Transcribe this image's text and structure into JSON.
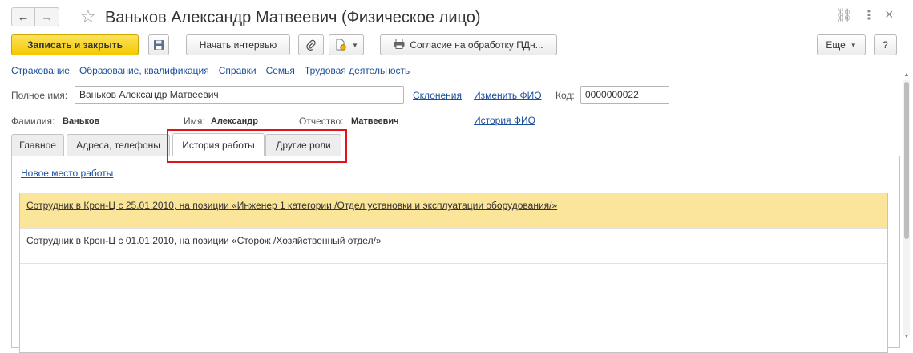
{
  "window": {
    "title": "Ваньков Александр Матвеевич (Физическое лицо)",
    "back_icon": "←",
    "forward_icon": "→",
    "favorite_icon": "☆",
    "link_icon": "⛓",
    "more_icon": "⋮",
    "close_icon": "×"
  },
  "toolbar": {
    "save_close_label": "Записать и закрыть",
    "start_interview_label": "Начать интервью",
    "consent_label": "Согласие на обработку ПДн...",
    "more_label": "Еще",
    "help_label": "?"
  },
  "links": [
    "Страхование",
    "Образование, квалификация",
    "Справки",
    "Семья",
    "Трудовая деятельность"
  ],
  "person": {
    "full_name_label": "Полное имя:",
    "full_name_value": "Ваньков Александр Матвеевич",
    "declensions_link": "Склонения",
    "change_name_link": "Изменить ФИО",
    "code_label": "Код:",
    "code_value": "0000000022",
    "surname_label": "Фамилия:",
    "surname_value": "Ваньков",
    "name_label": "Имя:",
    "name_value": "Александр",
    "patronymic_label": "Отчество:",
    "patronymic_value": "Матвеевич",
    "name_history_link": "История ФИО"
  },
  "tabs": [
    "Главное",
    "Адреса, телефоны",
    "История работы",
    "Другие роли"
  ],
  "active_tab": "История работы",
  "work_history": {
    "new_workplace_link": "Новое место работы",
    "items": [
      "Сотрудник в Крон-Ц с 25.01.2010, на позиции «Инженер 1 категории /Отдел установки и эксплуатации оборудования/»",
      "Сотрудник в Крон-Ц с 01.01.2010, на позиции «Сторож /Хозяйственный отдел/»"
    ]
  },
  "colors": {
    "primary_button": "#f4c900",
    "selected_row": "#fbe59a",
    "link": "#1b4f9c",
    "highlight_frame": "#e0131b"
  }
}
